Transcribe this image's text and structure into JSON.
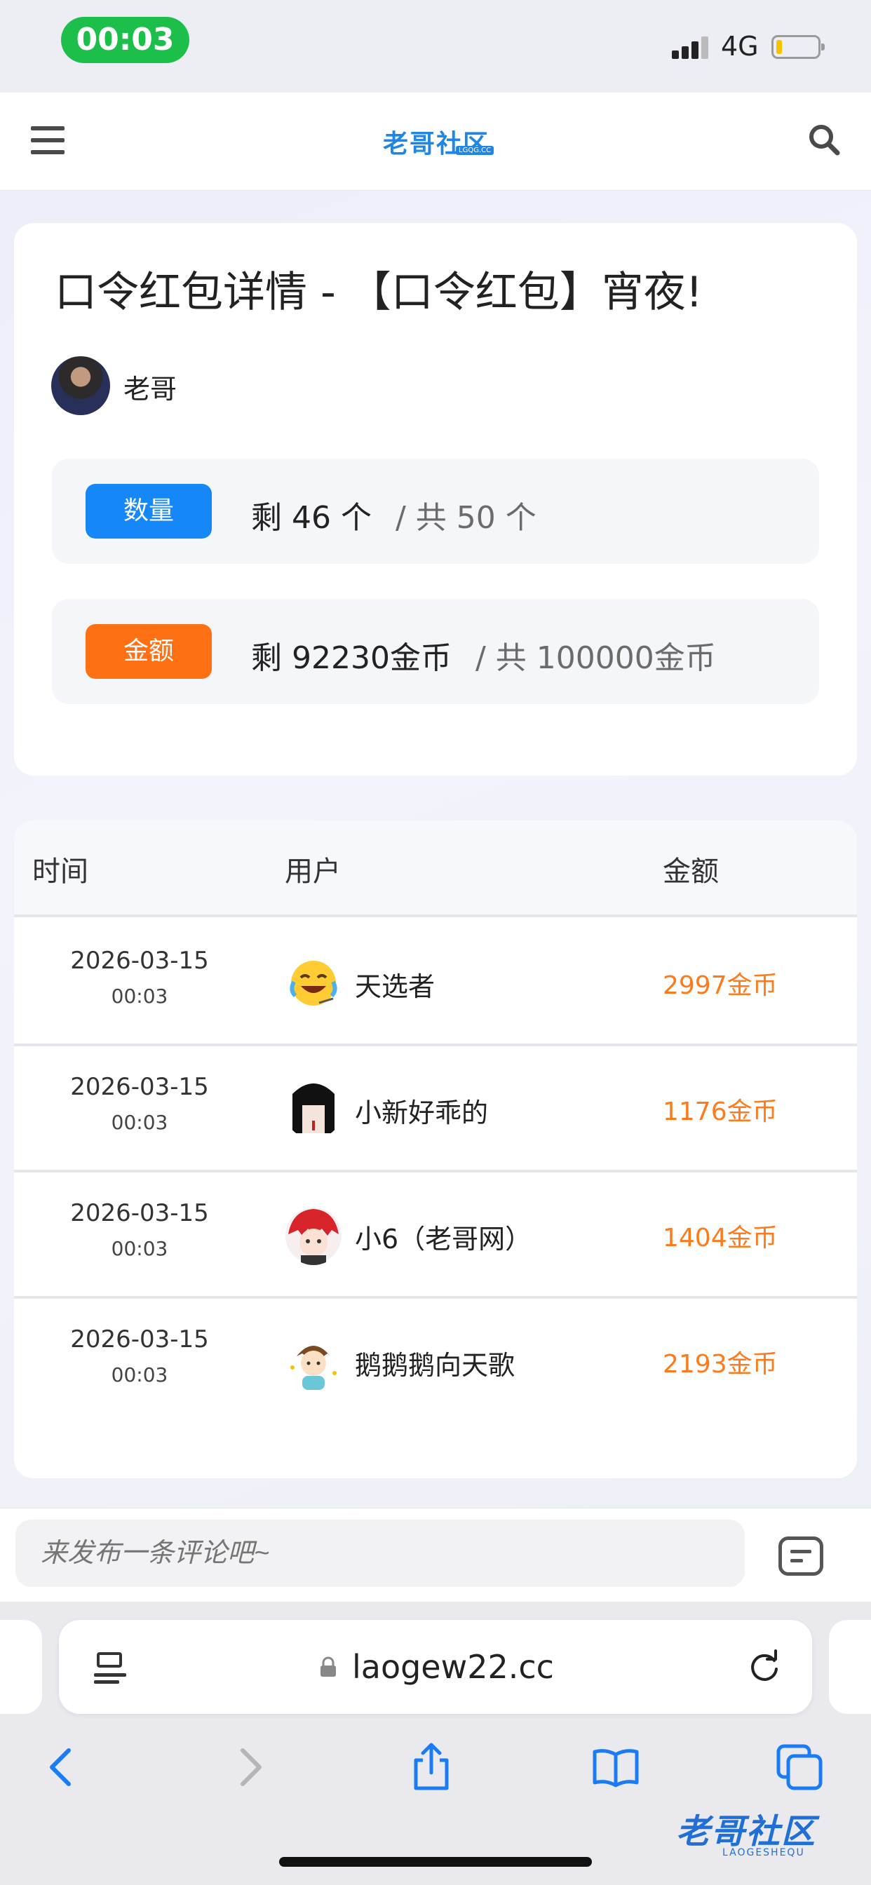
{
  "status_bar": {
    "time": "00:03",
    "network": "4G"
  },
  "header": {
    "logo_text": "老哥社区",
    "logo_sub": "LGQG.CC"
  },
  "detail": {
    "title": "口令红包详情 - 【口令红包】宵夜!",
    "author": "老哥",
    "quantity": {
      "tag": "数量",
      "remaining": "剩 46 个",
      "total": "/ 共 50 个"
    },
    "amount": {
      "tag": "金额",
      "remaining": "剩 92230金币",
      "total": "/ 共 100000金币"
    },
    "colors": {
      "blue_tag": "#1687f7",
      "orange_tag": "#ff6f13",
      "amount_text": "#ff7a1a"
    }
  },
  "table": {
    "headers": [
      "时间",
      "用户",
      "金额"
    ],
    "rows": [
      {
        "date": "2026-03-15",
        "time": "00:03",
        "user": "天选者",
        "amount": "2997金币",
        "avatar": "laughing-emoji-avatar"
      },
      {
        "date": "2026-03-15",
        "time": "00:03",
        "user": "小新好乖的",
        "amount": "1176金币",
        "avatar": "anime-girl-avatar"
      },
      {
        "date": "2026-03-15",
        "time": "00:03",
        "user": "小6（老哥网）",
        "amount": "1404金币",
        "avatar": "red-hair-anime-avatar"
      },
      {
        "date": "2026-03-15",
        "time": "00:03",
        "user": "鹅鹅鹅向天歌",
        "amount": "2193金币",
        "avatar": "cartoon-boy-avatar"
      }
    ]
  },
  "comment": {
    "placeholder": "来发布一条评论吧~"
  },
  "browser": {
    "url": "laogew22.cc"
  },
  "watermark": {
    "text": "老哥社区",
    "sub": "LAOGESHEQU"
  }
}
